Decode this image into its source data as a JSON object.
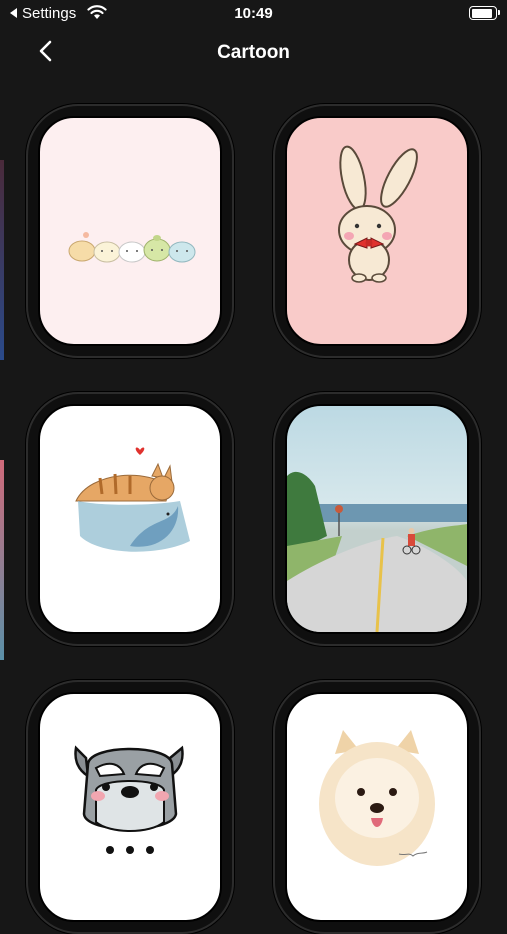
{
  "status_bar": {
    "back_app_label": "Settings",
    "time": "10:49",
    "battery_level": 0.9
  },
  "nav": {
    "title": "Cartoon",
    "back_icon": "chevron-left-icon"
  },
  "wallpapers": [
    {
      "name": "Animal friends row",
      "bg": "#fdeff0"
    },
    {
      "name": "Bunny with bow",
      "bg": "#f9cbc9"
    },
    {
      "name": "Cat and fish",
      "bg": "#ffffff"
    },
    {
      "name": "Road to the sea",
      "bg": "#bcd9e3"
    },
    {
      "name": "Schnauzer",
      "bg": "#ffffff"
    },
    {
      "name": "Pomeranian",
      "bg": "#ffffff"
    }
  ],
  "colors": {
    "background": "#171717",
    "bezel": "#0f0f0f",
    "accent_red": "#e0322e"
  }
}
